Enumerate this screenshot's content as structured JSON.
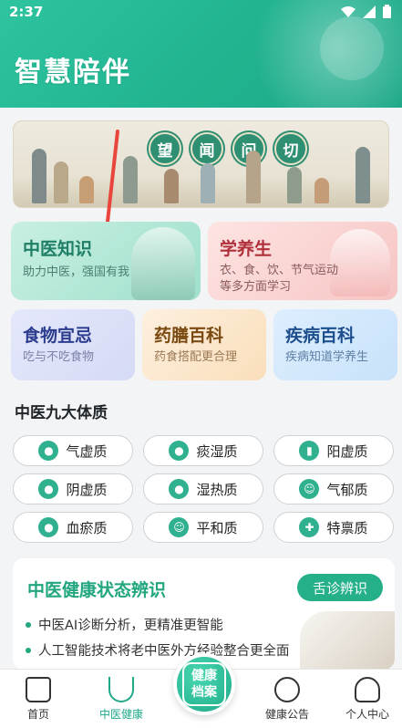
{
  "status_bar": {
    "time": "2:37"
  },
  "app": {
    "title": "智慧陪伴"
  },
  "banner": {
    "seal_chars": [
      "望",
      "闻",
      "问",
      "切"
    ]
  },
  "feature_cards": [
    {
      "title": "中医知识",
      "subtitle": "助力中医，强国有我"
    },
    {
      "title": "学养生",
      "subtitle": "衣、食、饮、节气运动等多方面学习"
    },
    {
      "title": "食物宜忌",
      "subtitle": "吃与不吃食物"
    },
    {
      "title": "药膳百科",
      "subtitle": "药食搭配更合理"
    },
    {
      "title": "疾病百科",
      "subtitle": "疾病知道学养生"
    }
  ],
  "constitution": {
    "title": "中医九大体质",
    "items": [
      "气虚质",
      "痰湿质",
      "阳虚质",
      "阴虚质",
      "湿热质",
      "气郁质",
      "血瘀质",
      "平和质",
      "特禀质"
    ]
  },
  "health_panel": {
    "title": "中医健康状态辨识",
    "tag": "舌诊辨识",
    "bullets": [
      "中医AI诊断分析，更精准更智能",
      "人工智能技术将老中医外方经验整合更全面"
    ]
  },
  "bottom_nav": {
    "items": [
      "首页",
      "中医健康",
      "健康公告",
      "个人中心"
    ],
    "center": [
      "健康",
      "档案"
    ],
    "active": "中医健康"
  },
  "colors": {
    "primary": "#21b38f",
    "accent": "#1fa989"
  }
}
